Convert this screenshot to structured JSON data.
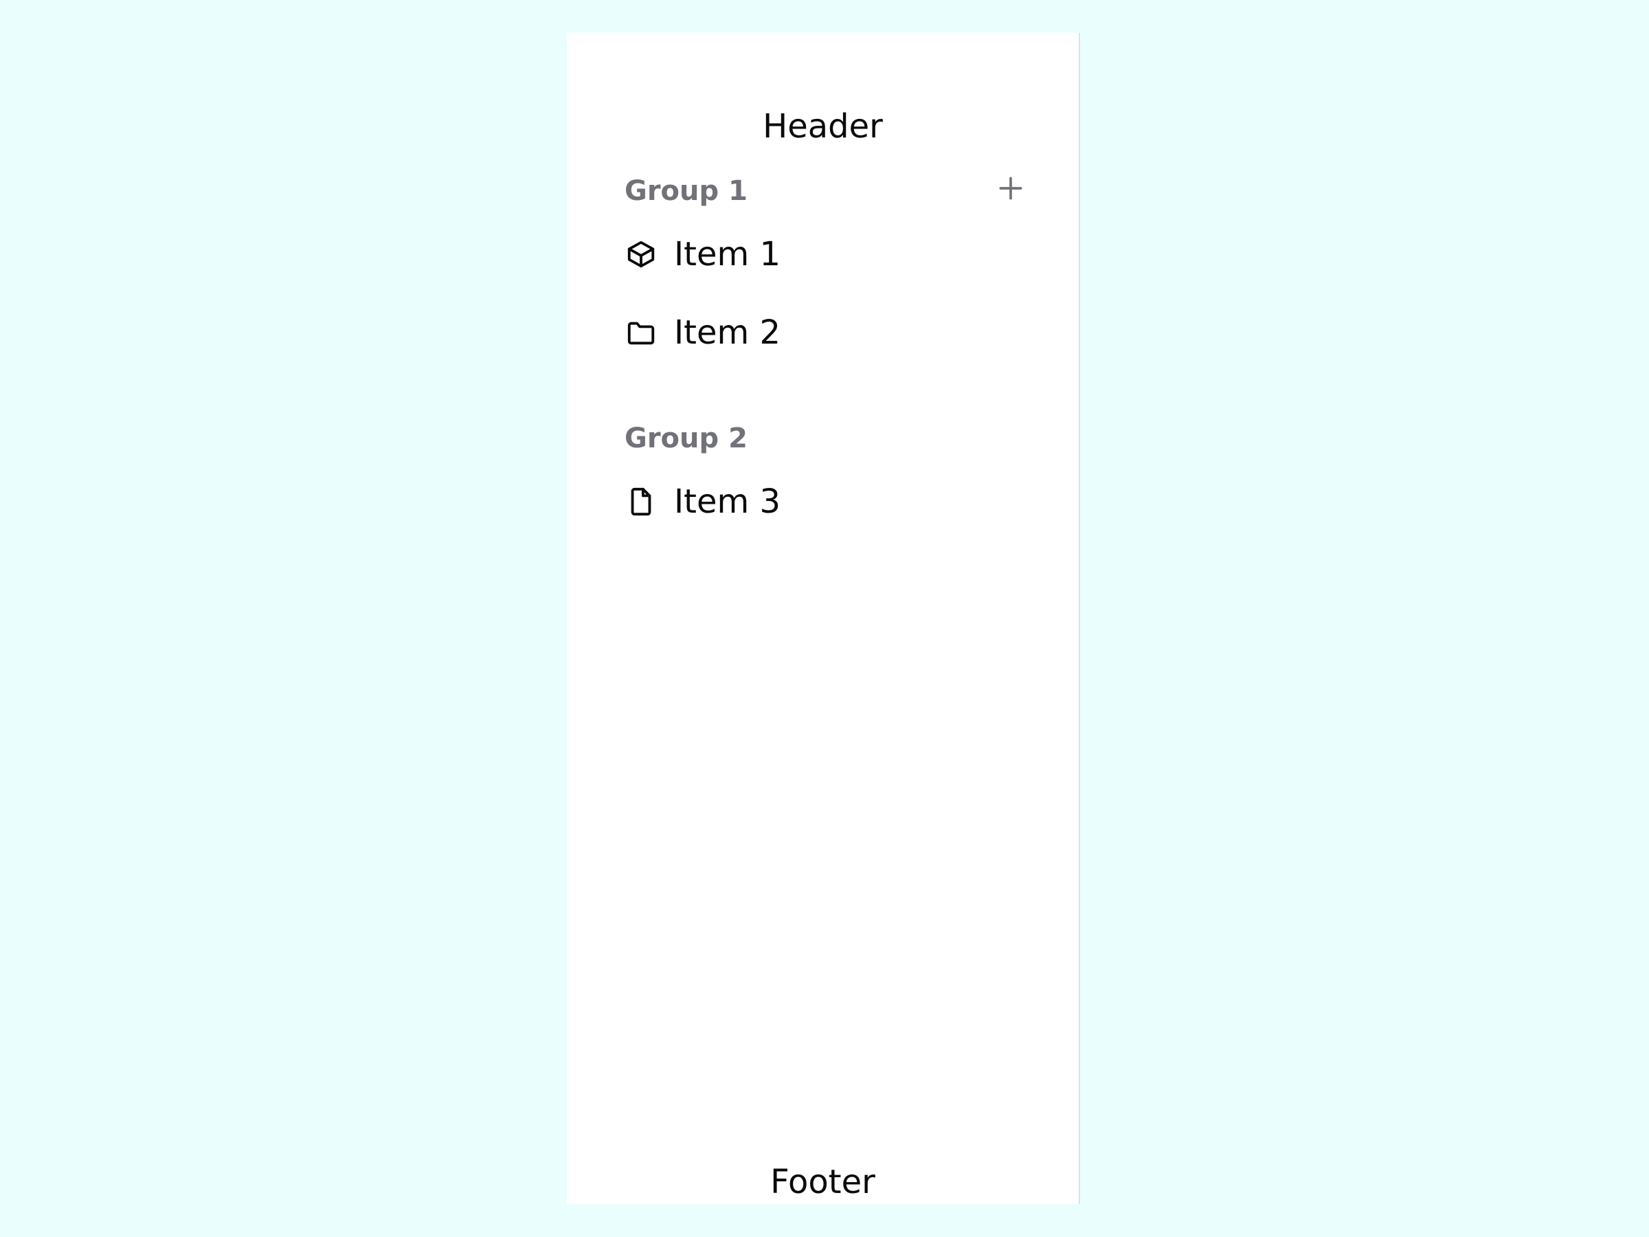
{
  "sidebar": {
    "header": "Header",
    "footer": "Footer",
    "groups": [
      {
        "label": "Group 1",
        "action_icon": "plus-icon",
        "items": [
          {
            "label": "Item 1",
            "icon": "box-icon"
          },
          {
            "label": "Item 2",
            "icon": "folder-icon"
          }
        ]
      },
      {
        "label": "Group 2",
        "items": [
          {
            "label": "Item 3",
            "icon": "file-icon"
          }
        ]
      }
    ]
  },
  "colors": {
    "page_background": "#ebfefe",
    "sidebar_background": "#ffffff",
    "group_label": "#71717a",
    "text": "#0a0a0a"
  }
}
